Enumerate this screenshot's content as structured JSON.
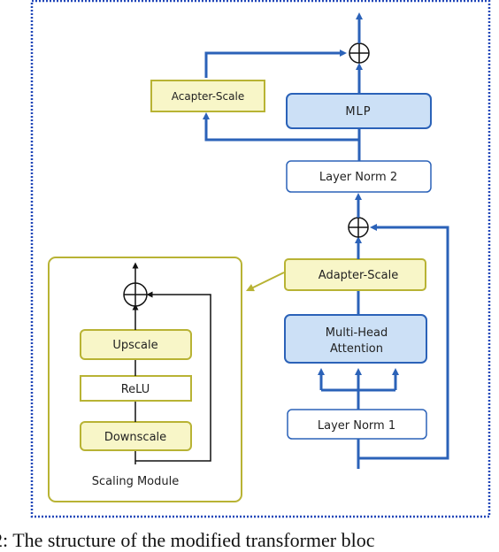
{
  "diagram": {
    "colors": {
      "flow_blue": "#2b62b8",
      "frame_dotted": "#2147b8",
      "adapter_fill": "#f8f6c8",
      "adapter_border": "#b8b334",
      "core_fill": "#cce0f6",
      "core_border": "#2b62b8",
      "white_box_border": "#2b62b8"
    },
    "transformer_block": {
      "adapter_scale_top": "Acapter-Scale",
      "mlp": "MLP",
      "layer_norm_2": "Layer Norm 2",
      "adapter_scale_mid": "Adapter-Scale",
      "multi_head_attention_line1": "Multi-Head",
      "multi_head_attention_line2": "Attention",
      "layer_norm_1": "Layer Norm 1"
    },
    "scaling_module": {
      "title": "Scaling Module",
      "upscale": "Upscale",
      "relu": "ReLU",
      "downscale": "Downscale"
    }
  },
  "caption": "2: The structure of the modified transformer bloc"
}
